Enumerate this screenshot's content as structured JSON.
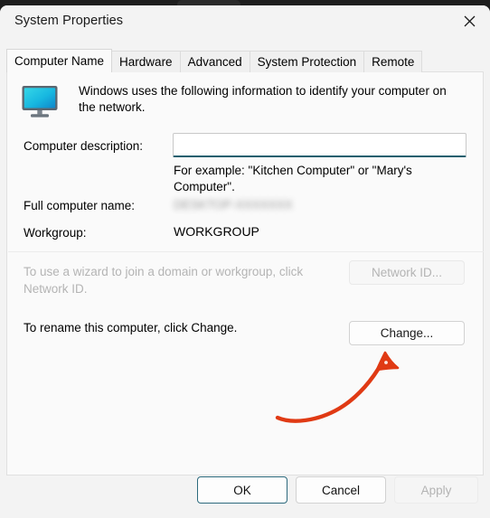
{
  "window": {
    "title": "System Properties",
    "close_icon": "close-icon"
  },
  "tabs": [
    {
      "label": "Computer Name",
      "active": true
    },
    {
      "label": "Hardware",
      "active": false
    },
    {
      "label": "Advanced",
      "active": false
    },
    {
      "label": "System Protection",
      "active": false
    },
    {
      "label": "Remote",
      "active": false
    }
  ],
  "panel": {
    "intro_icon": "monitor-icon",
    "intro_text": "Windows uses the following information to identify your computer on the network.",
    "description": {
      "label": "Computer description:",
      "value": "",
      "placeholder": "",
      "example_text": "For example: \"Kitchen Computer\" or \"Mary's Computer\"."
    },
    "full_computer_name": {
      "label": "Full computer name:",
      "value": "DESKTOP-XXXXXXX",
      "redacted": true
    },
    "workgroup": {
      "label": "Workgroup:",
      "value": "WORKGROUP"
    },
    "network_id": {
      "text": "To use a wizard to join a domain or workgroup, click Network ID.",
      "button_label": "Network ID...",
      "disabled": true
    },
    "change": {
      "text": "To rename this computer, click Change.",
      "button_label": "Change...",
      "disabled": false
    }
  },
  "annotation": {
    "name": "red-arrow-to-change-button",
    "color": "#e03a14"
  },
  "footer": {
    "ok_label": "OK",
    "cancel_label": "Cancel",
    "apply_label": "Apply",
    "apply_disabled": true
  },
  "colors": {
    "accent": "#2d6a7d",
    "dialog_bg": "#f3f3f3",
    "panel_bg": "#fafafa",
    "disabled_text": "#b4b4b4",
    "annotation_red": "#e03a14"
  }
}
